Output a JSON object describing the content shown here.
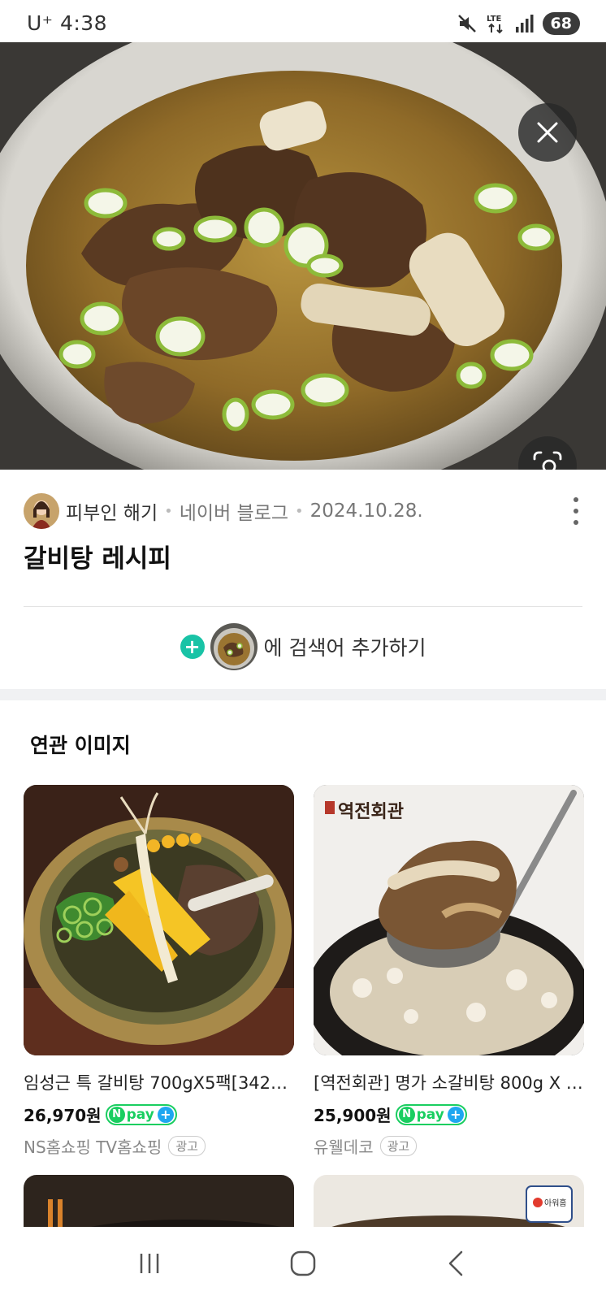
{
  "status_bar": {
    "carrier_time": "U⁺ 4:38",
    "network": "LTE",
    "battery": "68",
    "icons": [
      "mute-icon",
      "lte-icon",
      "signal-icon",
      "battery-icon"
    ]
  },
  "hero": {
    "image": "galbitang-beef-short-rib-soup-photo",
    "close_icon": "close-icon",
    "lens_icon": "image-search-icon"
  },
  "meta": {
    "author": "피부인 해기",
    "source": "네이버 블로그",
    "date": "2024.10.28."
  },
  "post_title": "갈비탕 레시피",
  "add_search": {
    "label": "에 검색어 추가하기"
  },
  "related": {
    "title": "연관 이미지",
    "items": [
      {
        "title": "임성근 특 갈비탕 700gX5팩[3429...",
        "price": "26,970원",
        "seller": "NS홈쇼핑 TV홈쇼핑",
        "ad": "광고"
      },
      {
        "title": "[역전회관] 명가 소갈비탕 800g X 4...",
        "price": "25,900원",
        "seller": "유웰데코",
        "ad": "광고",
        "brand_mark": "역전회관"
      }
    ],
    "npay": {
      "n": "N",
      "word": "pay",
      "plus": "+"
    },
    "partial_badge": "아워홈"
  },
  "colors": {
    "accent_teal": "#19c3a6",
    "npay_green": "#19ce60",
    "npay_blue": "#1ea7f0"
  }
}
